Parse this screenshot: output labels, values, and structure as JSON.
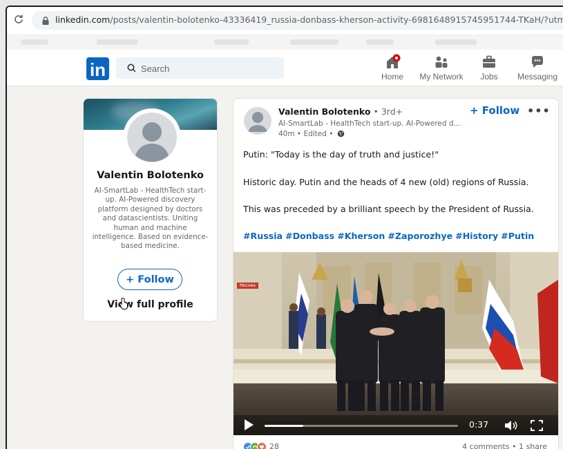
{
  "browser": {
    "url_host": "linkedin.com",
    "url_path": "/posts/valentin-bolotenko-43336419_russia-donbass-kherson-activity-6981648915745951744-TKaH/?utm_source=share&utm"
  },
  "header": {
    "search_placeholder": "Search",
    "nav": [
      {
        "label": "Home"
      },
      {
        "label": "My Network"
      },
      {
        "label": "Jobs"
      },
      {
        "label": "Messaging"
      }
    ]
  },
  "profile_card": {
    "name": "Valentin Bolotenko",
    "headline": "AI-SmartLab - HealthTech start-up. AI-Powered discovery platform designed by doctors and datascientists. Uniting human and machine intelligence. Based on evidence-based medicine.",
    "follow_label": "+ Follow",
    "view_profile_label": "View full profile"
  },
  "post": {
    "author_name": "Valentin Bolotenko",
    "author_degree": "• 3rd+",
    "author_headline": "AI-SmartLab - HealthTech start-up. AI-Powered d...",
    "time": "40m • Edited •",
    "follow_label": "+ Follow",
    "more_label": "•••",
    "text_lines": [
      "Putin: \"Today is the day of truth and justice!\"",
      "Historic day. Putin and the heads of 4 new (old) regions of Russia.",
      "This was preceded by a brilliant speech by the President of Russia."
    ],
    "hashtags": [
      "#Russia",
      "#Donbass",
      "#Kherson",
      "#Zaporozhye",
      "#History",
      "#Putin"
    ],
    "video": {
      "time": "0:37",
      "progress": 0.2,
      "overlay_label": "Москва"
    },
    "reactions_count": "28",
    "comments_shares": "4 comments • 1 share"
  }
}
